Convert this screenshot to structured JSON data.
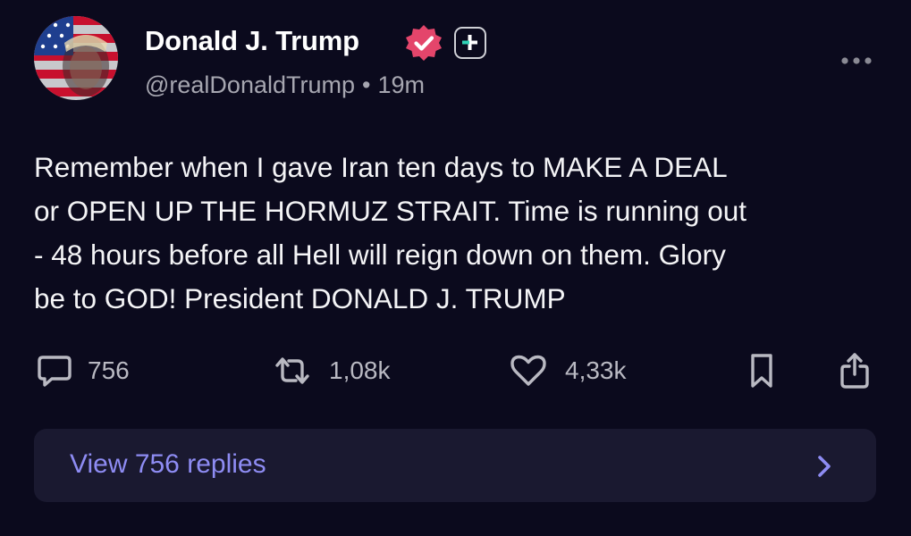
{
  "author": {
    "display_name": "Donald J. Trump",
    "handle": "@realDonaldTrump",
    "separator": "•",
    "time_ago": "19m"
  },
  "post": {
    "lines": [
      "Remember when I gave Iran ten days to MAKE A DEAL",
      "or OPEN UP THE HORMUZ STRAIT. Time is running out",
      "- 48 hours before all Hell will reign down on them. Glory",
      "be to GOD! President DONALD J. TRUMP"
    ]
  },
  "actions": {
    "replies_count": "756",
    "reposts_count": "1,08k",
    "likes_count": "4,33k"
  },
  "replies_link": {
    "label": "View 756 replies"
  },
  "icons": {
    "avatar": "flag-portrait-avatar",
    "verified": "verified-badge-icon",
    "plus": "plus-badge-icon",
    "more": "more-options-icon",
    "reply": "reply-bubble-icon",
    "repost": "repost-icon",
    "like": "heart-icon",
    "bookmark": "bookmark-icon",
    "share": "share-icon",
    "chevron": "chevron-right-icon"
  },
  "colors": {
    "background": "#0b0a1d",
    "verified_badge": "#e4456b",
    "plus_badge_accent": "#2fd3b6",
    "link": "#8e8cf3",
    "replies_bar": "#1a1930",
    "muted_text": "#a6a6b0"
  }
}
